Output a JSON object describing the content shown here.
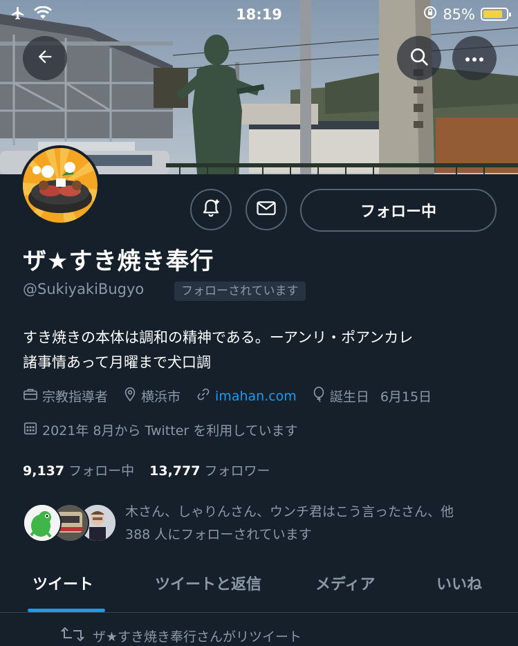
{
  "status_bar": {
    "time": "18:19",
    "battery": "85%",
    "battery_level": 0.85,
    "icons": [
      "airplane-icon",
      "wifi-icon",
      "orientation-lock-icon",
      "battery-icon"
    ]
  },
  "header_nav": {
    "icons": [
      "arrow-left-icon",
      "search-icon",
      "more-icon"
    ]
  },
  "profile": {
    "display_name": "ザ★すき焼き奉行",
    "handle": "@SukiyakiBugyo",
    "follows_you": "フォローされています",
    "bio_line1": "すき焼きの本体は調和の精神である。ーアンリ・ポアンカレ",
    "bio_line2": "諸事情あって月曜まで犬口調",
    "category": "宗教指導者",
    "location": "横浜市",
    "website": "imahan.com",
    "birthday_label": "誕生日",
    "birthday_value": "6月15日",
    "joined": "2021年 8月から Twitter を利用しています",
    "following_count": "9,137",
    "following_label": "フォロー中",
    "followers_count": "13,777",
    "followers_label": "フォロワー",
    "known_followers_line1": "木さん、しゃりんさん、ウンチ君はこう言ったさん、他",
    "known_followers_line2": "388 人にフォローされています"
  },
  "actions": {
    "follow_button": "フォロー中",
    "icons": [
      "bell-plus-icon",
      "envelope-icon"
    ]
  },
  "tabs": [
    {
      "label": "ツイート",
      "active": true
    },
    {
      "label": "ツイートと返信",
      "active": false
    },
    {
      "label": "メディア",
      "active": false
    },
    {
      "label": "いいね",
      "active": false
    }
  ],
  "timeline": {
    "retweet_header": "ザ★すき焼き奉行さんがリツイート"
  },
  "colors": {
    "background": "#15202b",
    "accent": "#1d9bf0",
    "secondary_text": "#8b98a5",
    "border": "#536471",
    "battery": "#f5d142"
  }
}
